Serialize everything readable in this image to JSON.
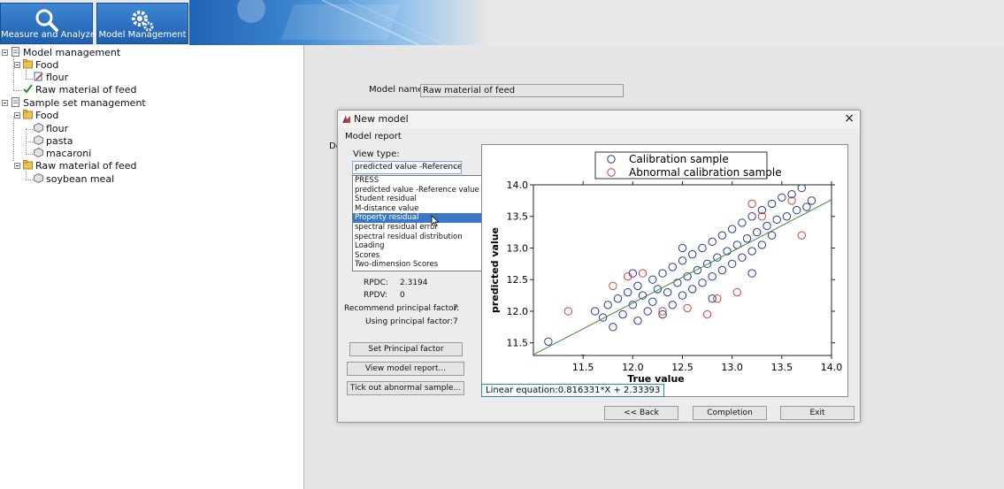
{
  "header": {
    "nav": [
      {
        "label": "Measure and Analyze",
        "icon": "search-icon"
      },
      {
        "label": "Model Management",
        "icon": "gears-icon"
      }
    ]
  },
  "tree": {
    "nodes": [
      {
        "label": "Model management",
        "icon": "document-icon"
      },
      {
        "label": "Food",
        "icon": "folder-icon"
      },
      {
        "label": "flour",
        "icon": "edit-model-icon"
      },
      {
        "label": "Raw material of feed",
        "icon": "checkmark-icon"
      },
      {
        "label": "Sample set management",
        "icon": "document-icon"
      },
      {
        "label": "Food",
        "icon": "folder-icon"
      },
      {
        "label": "flour",
        "icon": "sample-icon"
      },
      {
        "label": "pasta",
        "icon": "sample-icon"
      },
      {
        "label": "macaroni",
        "icon": "sample-icon"
      },
      {
        "label": "Raw material of feed",
        "icon": "folder-icon"
      },
      {
        "label": "soybean meal",
        "icon": "sample-icon"
      }
    ]
  },
  "main": {
    "model_name_label": "Model name:",
    "model_name_value": "Raw material of feed",
    "de_label": "De"
  },
  "dialog": {
    "title": "New model",
    "close": "×",
    "report_label": "Model report",
    "view_type_label": "View type:",
    "view_type_value": "predicted value -Reference v",
    "options": [
      "PRESS",
      "predicted value -Reference value",
      "Student residual",
      "M-distance value",
      "Property residual",
      "spectral residual error",
      "spectral residual distribution",
      "Loading",
      "Scores",
      "Two-dimension Scores"
    ],
    "selected_index": 4,
    "stats": {
      "rpdc_label": "RPDC:",
      "rpdc_value": "2.3194",
      "rpdv_label": "RPDV:",
      "rpdv_value": "0",
      "recommend_label": "Recommend principal factor:",
      "recommend_value": "7",
      "using_label": "Using principal factor:",
      "using_value": "7"
    },
    "buttons": {
      "set_principal": "Set Principal factor",
      "view_report": "View model report...",
      "tick_out": "Tick out abnormal sample...",
      "back": "<< Back",
      "completion": "Completion",
      "exit": "Exit"
    },
    "linear_equation": "Linear equation:0.816331*X + 2.33393"
  },
  "colors": {
    "calibration": "#2b3a8f",
    "abnormal": "#c9473d",
    "fit_line": "#3b8a3b",
    "selection": "#3a78c5"
  },
  "chart_data": {
    "type": "scatter",
    "xlabel": "True value",
    "ylabel": "predicted value",
    "xlim": [
      11.0,
      14.0
    ],
    "ylim": [
      11.3,
      14.0
    ],
    "xticks": [
      "11.5",
      "12.0",
      "12.5",
      "13.0",
      "13.5",
      "14.0"
    ],
    "yticks": [
      "11.5",
      "12.0",
      "12.5",
      "13.0",
      "13.5",
      "14.0"
    ],
    "legend_position": "top",
    "fit": {
      "slope": 0.816331,
      "intercept": 2.33393
    },
    "series": [
      {
        "name": "Calibration sample",
        "points": [
          [
            11.15,
            11.52
          ],
          [
            11.5,
            11.25
          ],
          [
            11.62,
            12.0
          ],
          [
            11.7,
            11.9
          ],
          [
            11.75,
            12.1
          ],
          [
            11.8,
            11.75
          ],
          [
            11.85,
            12.2
          ],
          [
            11.9,
            11.95
          ],
          [
            11.95,
            12.3
          ],
          [
            12.0,
            12.1
          ],
          [
            12.05,
            11.85
          ],
          [
            12.05,
            12.4
          ],
          [
            12.1,
            12.25
          ],
          [
            12.15,
            12.0
          ],
          [
            12.2,
            12.5
          ],
          [
            12.2,
            12.15
          ],
          [
            12.25,
            12.35
          ],
          [
            12.3,
            11.95
          ],
          [
            12.3,
            12.6
          ],
          [
            12.35,
            12.3
          ],
          [
            12.4,
            12.7
          ],
          [
            12.4,
            12.1
          ],
          [
            12.45,
            12.45
          ],
          [
            12.5,
            12.8
          ],
          [
            12.5,
            12.25
          ],
          [
            12.55,
            12.55
          ],
          [
            12.6,
            12.9
          ],
          [
            12.6,
            12.35
          ],
          [
            12.65,
            12.65
          ],
          [
            12.7,
            13.0
          ],
          [
            12.7,
            12.45
          ],
          [
            12.75,
            12.75
          ],
          [
            12.8,
            13.1
          ],
          [
            12.8,
            12.55
          ],
          [
            12.85,
            12.85
          ],
          [
            12.9,
            13.2
          ],
          [
            12.9,
            12.65
          ],
          [
            12.95,
            12.95
          ],
          [
            13.0,
            13.3
          ],
          [
            13.0,
            12.75
          ],
          [
            13.05,
            13.05
          ],
          [
            13.1,
            13.4
          ],
          [
            13.1,
            12.85
          ],
          [
            13.15,
            13.15
          ],
          [
            13.2,
            13.5
          ],
          [
            13.2,
            12.95
          ],
          [
            13.25,
            13.25
          ],
          [
            13.3,
            13.6
          ],
          [
            13.3,
            13.05
          ],
          [
            13.35,
            13.35
          ],
          [
            13.4,
            13.7
          ],
          [
            13.4,
            13.2
          ],
          [
            13.45,
            13.45
          ],
          [
            13.5,
            13.8
          ],
          [
            13.55,
            13.5
          ],
          [
            13.6,
            13.85
          ],
          [
            13.65,
            13.6
          ],
          [
            13.7,
            13.95
          ],
          [
            13.75,
            13.65
          ],
          [
            13.8,
            13.75
          ],
          [
            12.0,
            12.6
          ],
          [
            12.5,
            13.0
          ],
          [
            12.8,
            12.2
          ],
          [
            13.2,
            12.6
          ]
        ]
      },
      {
        "name": "Abnormal calibration sample",
        "points": [
          [
            11.35,
            12.0
          ],
          [
            11.8,
            12.4
          ],
          [
            11.95,
            12.55
          ],
          [
            12.1,
            12.6
          ],
          [
            12.3,
            12.0
          ],
          [
            12.55,
            12.05
          ],
          [
            12.75,
            11.95
          ],
          [
            12.85,
            12.2
          ],
          [
            13.05,
            12.3
          ],
          [
            13.2,
            13.7
          ],
          [
            13.3,
            13.5
          ],
          [
            13.7,
            13.2
          ],
          [
            13.6,
            13.75
          ]
        ]
      }
    ]
  }
}
